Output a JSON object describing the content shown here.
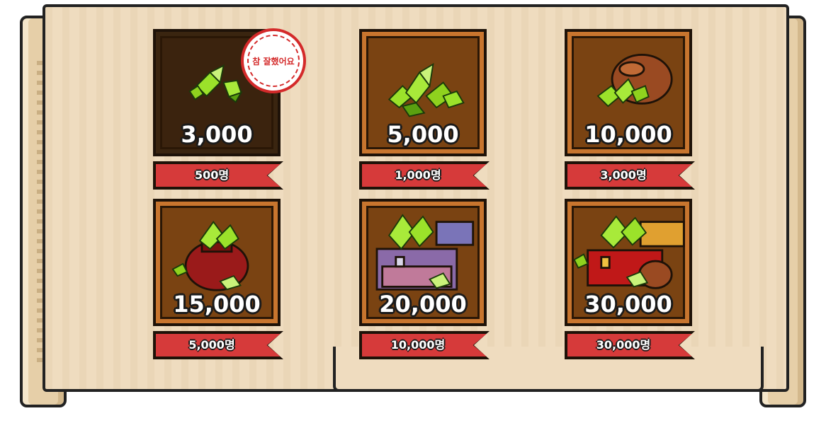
{
  "rewards": [
    {
      "amount": "3,000",
      "requirement": "500명",
      "completed": true
    },
    {
      "amount": "5,000",
      "requirement": "1,000명",
      "completed": false
    },
    {
      "amount": "10,000",
      "requirement": "3,000명",
      "completed": false
    },
    {
      "amount": "15,000",
      "requirement": "5,000명",
      "completed": false
    },
    {
      "amount": "20,000",
      "requirement": "10,000명",
      "completed": false
    },
    {
      "amount": "30,000",
      "requirement": "30,000명",
      "completed": false
    }
  ],
  "stamp": {
    "text": "참 잘했어요"
  },
  "colors": {
    "gem_green": "#9be22a",
    "ribbon_red": "#d63a3a",
    "card_frame": "#c8752e",
    "card_inner": "#7a4312",
    "parchment": "#efdcbf",
    "stamp_red": "#d42a2a"
  },
  "icons": [
    "gem-pile-small-icon",
    "gem-pile-icon",
    "gem-sack-icon",
    "gem-pot-icon",
    "gem-chest-icon",
    "gem-chest-sack-icon"
  ]
}
